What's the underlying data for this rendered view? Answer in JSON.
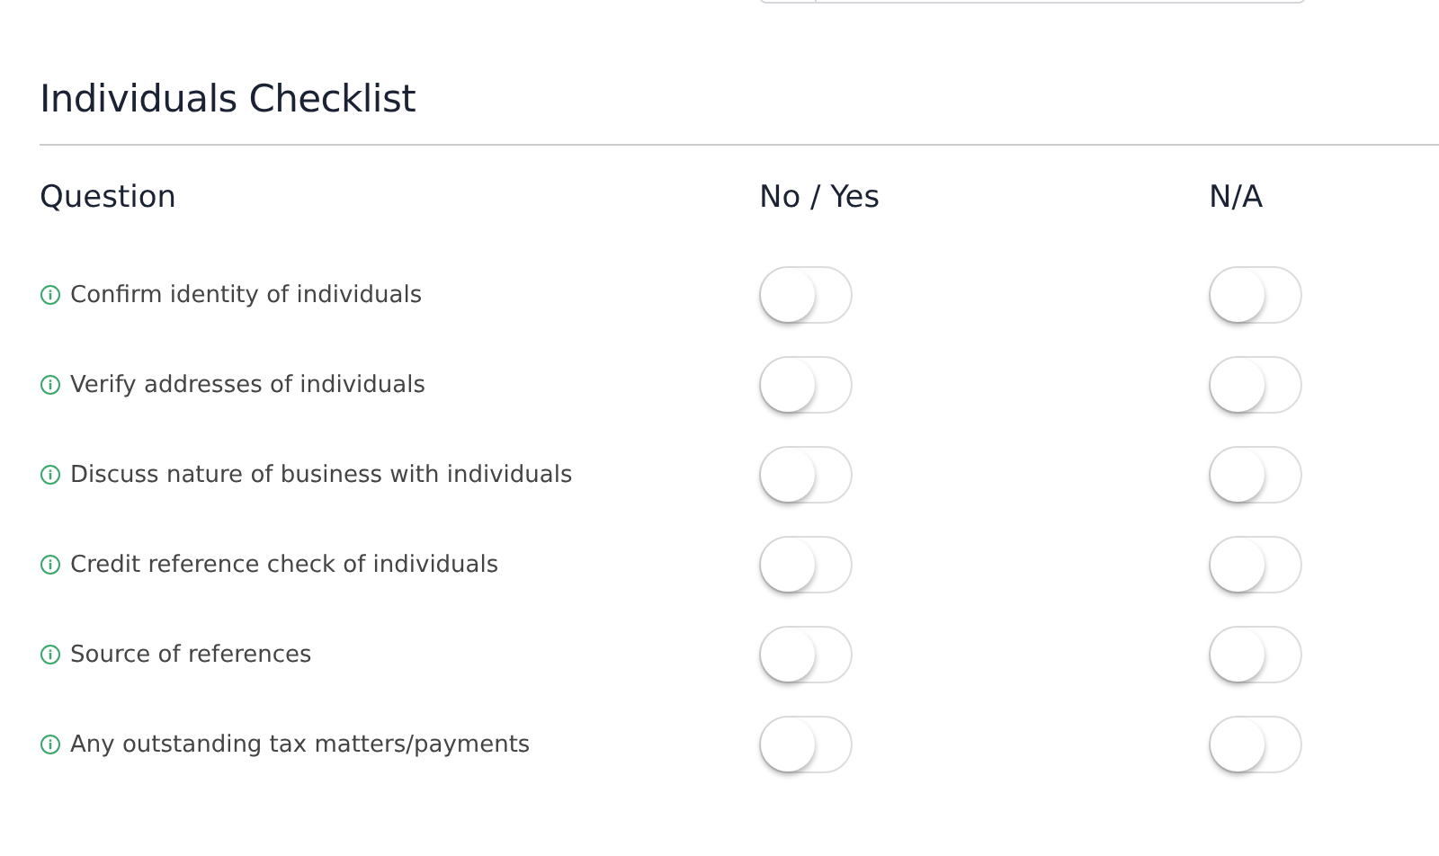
{
  "title": "Individuals Checklist",
  "columns": [
    "Question",
    "No / Yes",
    "N/A"
  ],
  "rows": [
    {
      "question": "Confirm identity of individuals",
      "yes": false,
      "na": false
    },
    {
      "question": "Verify addresses of individuals",
      "yes": false,
      "na": false
    },
    {
      "question": "Discuss nature of business with individuals",
      "yes": false,
      "na": false
    },
    {
      "question": "Credit reference check of individuals",
      "yes": false,
      "na": false
    },
    {
      "question": "Source of references",
      "yes": false,
      "na": false
    },
    {
      "question": "Any outstanding tax matters/payments",
      "yes": false,
      "na": false
    }
  ]
}
